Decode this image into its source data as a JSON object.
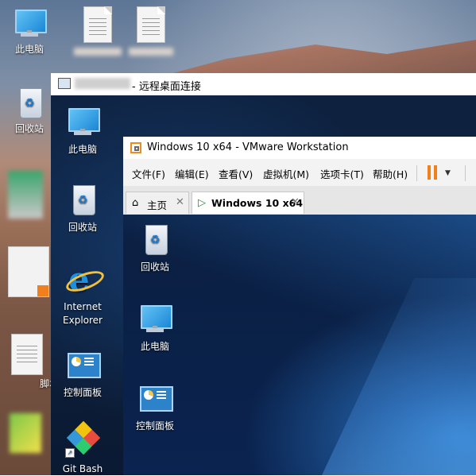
{
  "outer_desktop": {
    "icons": [
      {
        "label": "此电脑"
      },
      {
        "label": "回收站"
      }
    ],
    "partial_label": "脚本"
  },
  "rdp_window": {
    "title": "远程桌面连接",
    "title_prefix": "-",
    "icons": [
      {
        "label": "此电脑"
      },
      {
        "label": "回收站"
      },
      {
        "label": "Internet Explorer"
      },
      {
        "label": "控制面板"
      },
      {
        "label": "Git Bash"
      }
    ]
  },
  "vmware_window": {
    "title": "Windows 10 x64 - VMware Workstation",
    "menu": [
      "文件(F)",
      "编辑(E)",
      "查看(V)",
      "虚拟机(M)",
      "选项卡(T)",
      "帮助(H)"
    ],
    "tabs": [
      {
        "label": "主页",
        "icon": "home-icon"
      },
      {
        "label": "Windows 10 x64",
        "icon": "vm-play-icon",
        "active": true
      }
    ],
    "guest_icons": [
      {
        "label": "回收站"
      },
      {
        "label": "此电脑"
      },
      {
        "label": "控制面板"
      }
    ]
  },
  "colors": {
    "vmware_accent": "#f07f1c",
    "windows_blue": "#1b86d6"
  }
}
